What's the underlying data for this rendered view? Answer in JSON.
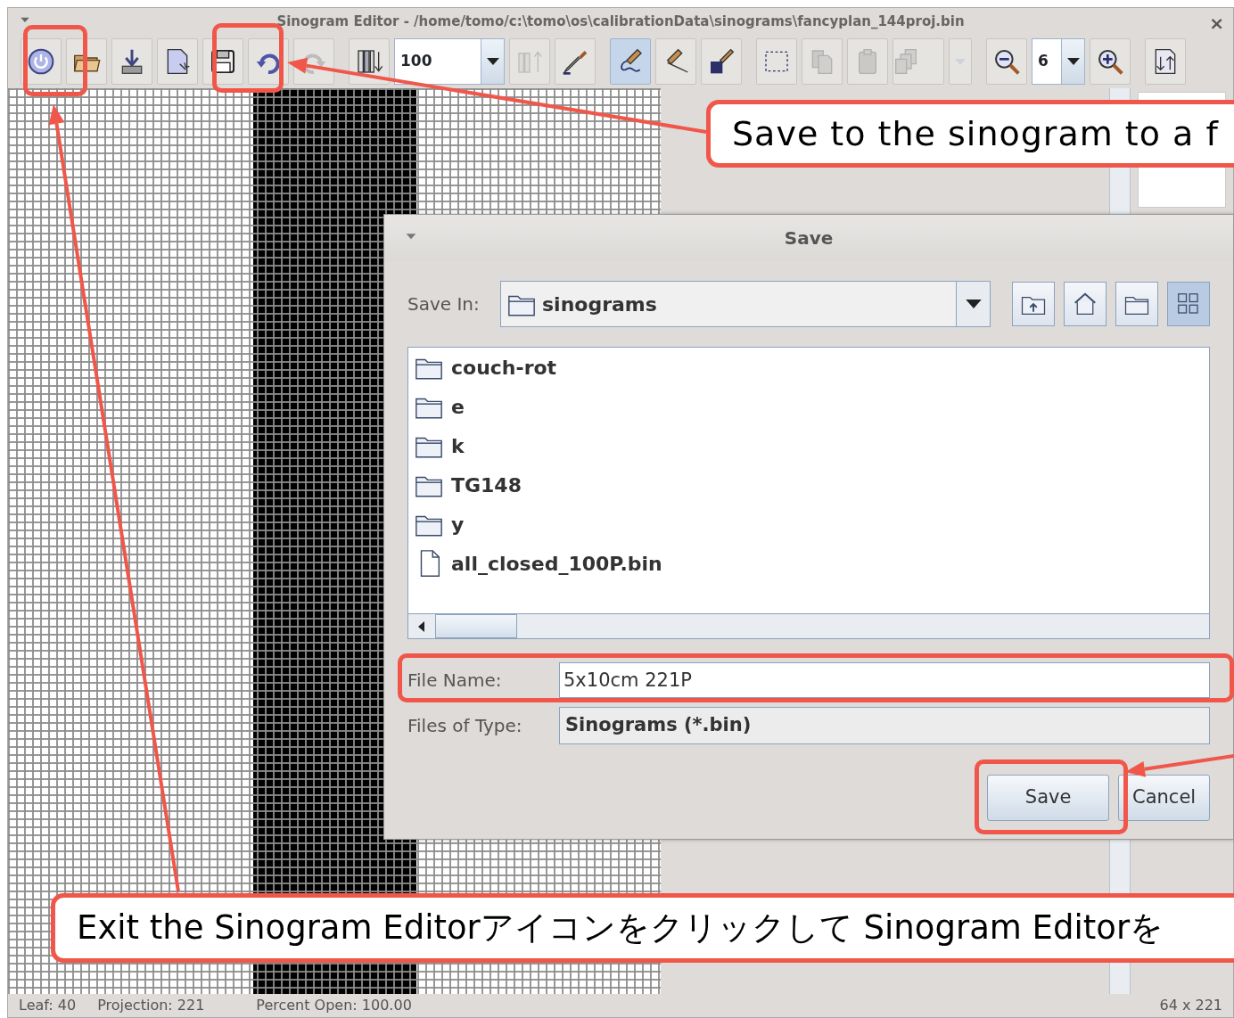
{
  "window": {
    "title": "Sinogram Editor - /home/tomo/c:\\tomo\\os\\calibrationData\\sinograms\\fancyplan_144proj.bin",
    "close": "×"
  },
  "toolbar": [
    [
      {
        "kind": "button",
        "selected": false,
        "disabled": false
      },
      {
        "kind": "button",
        "selected": false,
        "disabled": false
      },
      {
        "kind": "button",
        "selected": false,
        "disabled": false
      },
      {
        "kind": "button",
        "selected": false,
        "disabled": false
      },
      {
        "kind": "button",
        "selected": false,
        "disabled": false
      },
      {
        "kind": "button",
        "selected": false,
        "disabled": false
      },
      {
        "kind": "button",
        "selected": false,
        "disabled": true
      }
    ],
    [
      {
        "kind": "button",
        "selected": false,
        "disabled": false
      },
      {
        "kind": "combo",
        "value": "100"
      },
      {
        "kind": "button",
        "selected": false,
        "disabled": true
      },
      {
        "kind": "button",
        "selected": false,
        "disabled": false
      }
    ],
    [
      {
        "kind": "button",
        "selected": true,
        "disabled": false
      },
      {
        "kind": "button",
        "selected": false,
        "disabled": false
      },
      {
        "kind": "button",
        "selected": false,
        "disabled": false
      }
    ],
    [
      {
        "kind": "button",
        "selected": false,
        "disabled": false
      },
      {
        "kind": "button",
        "selected": false,
        "disabled": true
      },
      {
        "kind": "button",
        "selected": false,
        "disabled": true
      },
      {
        "kind": "split",
        "selected": false,
        "disabled": true
      }
    ],
    [
      {
        "kind": "button",
        "selected": false,
        "disabled": false
      },
      {
        "kind": "combo",
        "value": "6"
      },
      {
        "kind": "button",
        "selected": false,
        "disabled": false
      }
    ],
    [
      {
        "kind": "button",
        "selected": false,
        "disabled": false
      }
    ]
  ],
  "dialog": {
    "title": "Save",
    "save_in_label": "Save In:",
    "save_in_value": "sinograms",
    "nav_buttons": [
      {
        "selected": false
      },
      {
        "selected": false
      },
      {
        "selected": false
      },
      {
        "selected": true
      }
    ],
    "files": [
      {
        "name": "couch-rot",
        "kind": "folder"
      },
      {
        "name": "e",
        "kind": "folder"
      },
      {
        "name": "k",
        "kind": "folder"
      },
      {
        "name": "TG148",
        "kind": "folder"
      },
      {
        "name": "y",
        "kind": "folder"
      },
      {
        "name": "all_closed_100P.bin",
        "kind": "file"
      }
    ],
    "file_name_label": "File Name:",
    "file_name": "5x10cm 221P",
    "type_label": "Files of Type:",
    "type_value": "Sinograms (*.bin)",
    "buttons": [
      "Save",
      "Cancel"
    ]
  },
  "callouts": [
    "Save to the sinogram to a f",
    "Exit the Sinogram Editorアイコンをクリックして Sinogram Editorを"
  ],
  "status_bar": {
    "leaf": "Leaf: 40",
    "projection": "Projection: 221",
    "percent_open": "Percent Open: 100.00",
    "size": "64 x 221"
  }
}
